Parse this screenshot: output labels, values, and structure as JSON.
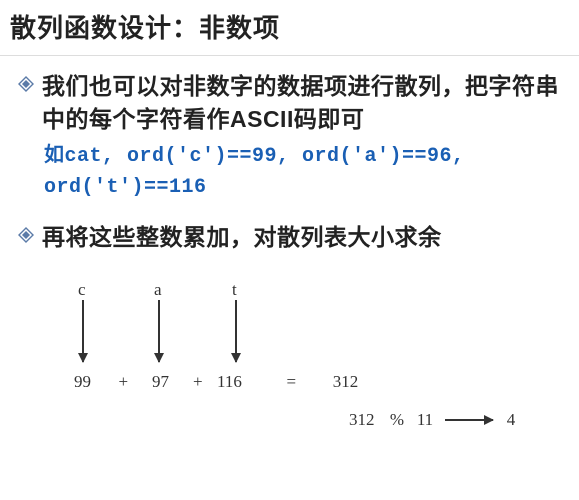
{
  "title": "散列函数设计：非数项",
  "bullets": [
    "我们也可以对非数字的数据项进行散列，把字符串中的每个字符看作ASCII码即可",
    "再将这些整数累加，对散列表大小求余"
  ],
  "code": {
    "line1": "如cat, ord('c')==99, ord('a')==96,",
    "line2": "ord('t')==116"
  },
  "diagram": {
    "chars": [
      "c",
      "a",
      "t"
    ],
    "nums": [
      "99",
      "97",
      "116"
    ],
    "plus": "+",
    "eq": "=",
    "sum": "312",
    "mod_left": "312",
    "mod_op": "%",
    "mod_right": "11",
    "result": "4"
  }
}
